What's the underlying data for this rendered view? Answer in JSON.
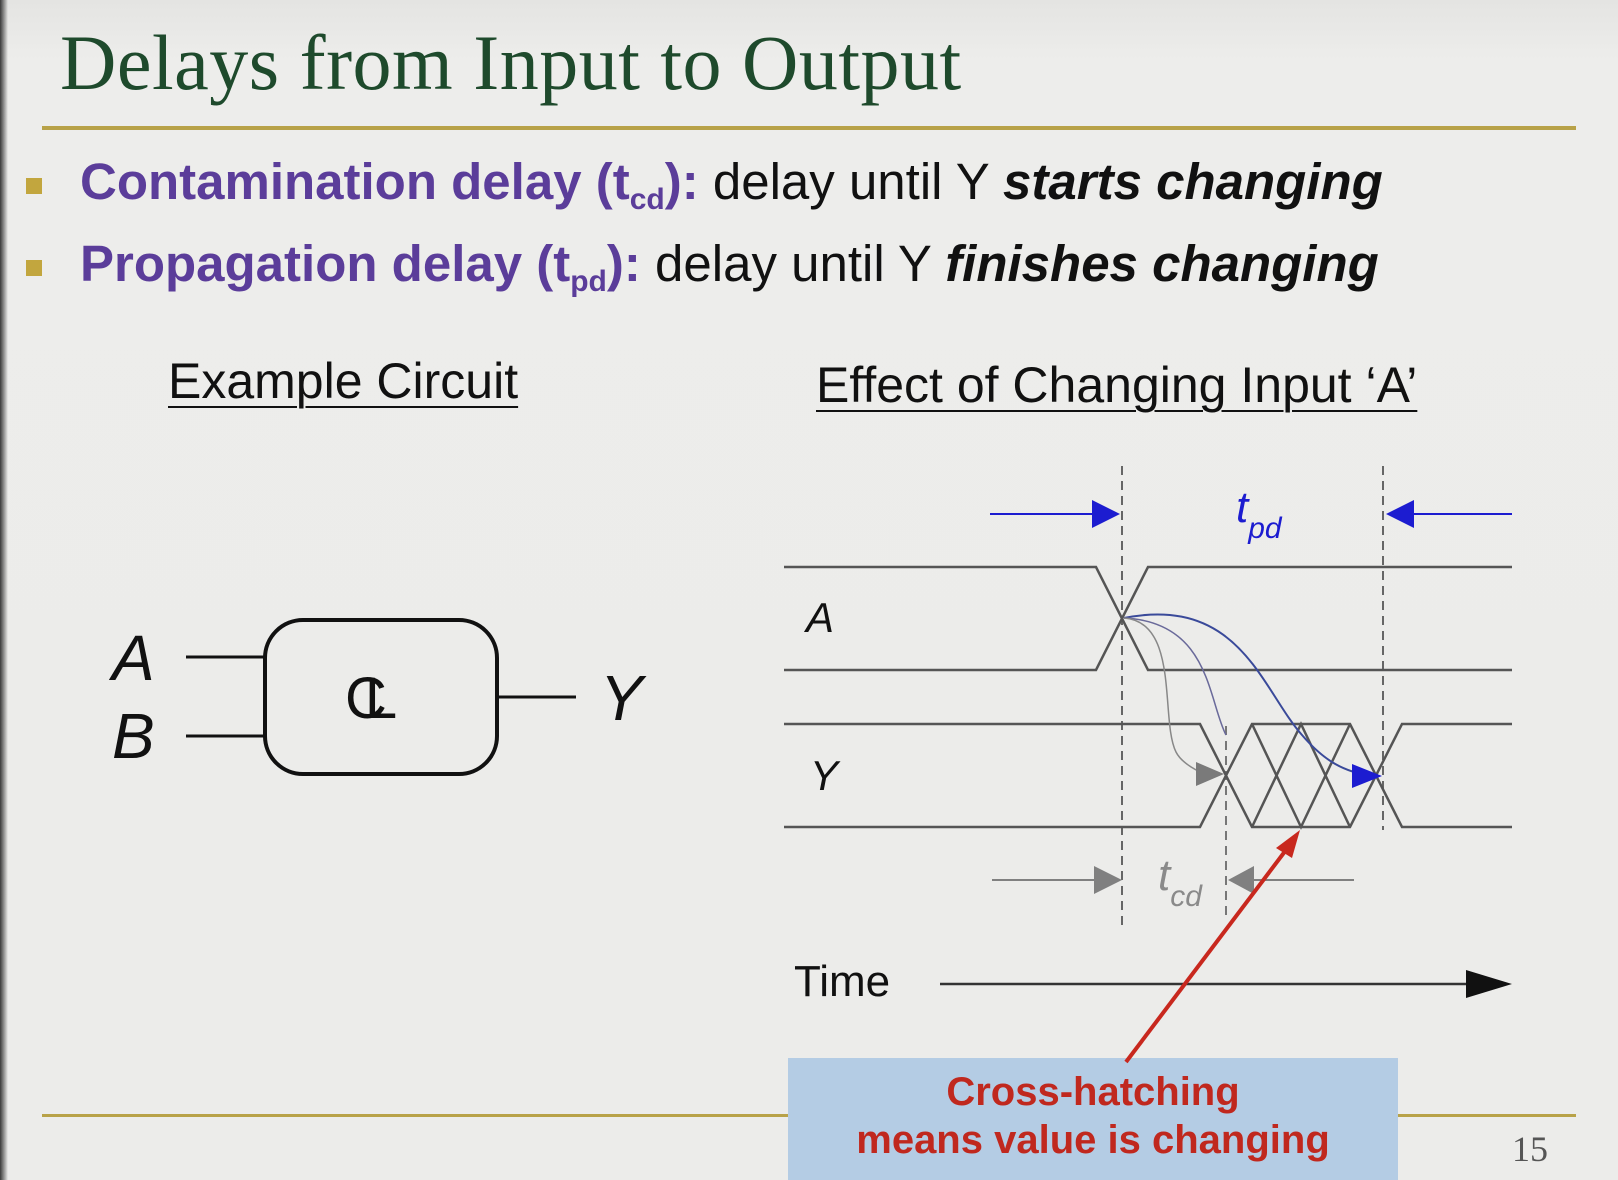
{
  "slide": {
    "title": "Delays from Input to Output",
    "page_number": "15"
  },
  "bullets": [
    {
      "term": "Contamination delay (t",
      "term_sub": "cd",
      "term_end": "):",
      "desc": " delay until Y ",
      "emph": "starts changing"
    },
    {
      "term": "Propagation delay (t",
      "term_sub": "pd",
      "term_end": "):",
      "desc": " delay until Y ",
      "emph": "finishes changing"
    }
  ],
  "example_circuit": {
    "heading": "Example Circuit",
    "inputs": [
      "A",
      "B"
    ],
    "block_label": "CL",
    "output": "Y"
  },
  "timing": {
    "heading": "Effect of Changing Input ‘A’",
    "signal_a": "A",
    "signal_y": "Y",
    "tpd_t": "t",
    "tpd_sub": "pd",
    "tcd_t": "t",
    "tcd_sub": "cd",
    "time_label": "Time"
  },
  "callout": {
    "line1": "Cross-hatching",
    "line2": "means value is changing"
  },
  "colors": {
    "title": "#1e4a2c",
    "term": "#5b3d9a",
    "rule": "#b8a248",
    "tpd_arrow": "#1c1cd0",
    "tcd_arrow": "#808080",
    "callout_bg": "#b4cce4",
    "callout_text": "#c0281e",
    "pointer": "#c8281e"
  }
}
